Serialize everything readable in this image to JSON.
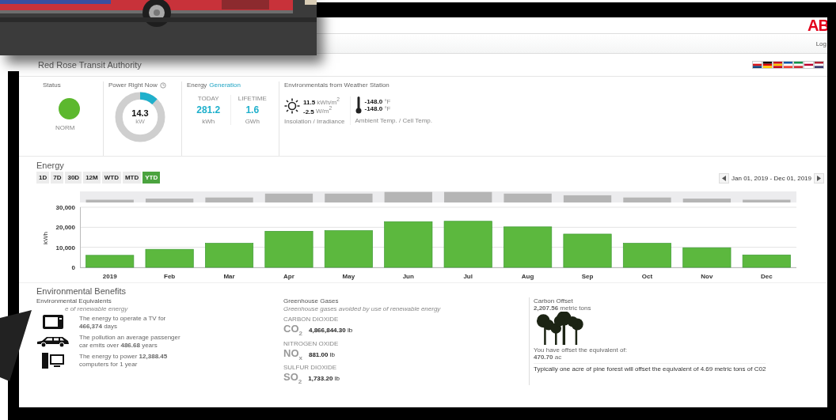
{
  "header": {
    "logo": "AB",
    "nav_link": "Log"
  },
  "title": "Red Rose Transit Authority",
  "kpis": {
    "status": {
      "label": "Status",
      "value": "NORM",
      "color": "#5cb82e"
    },
    "power": {
      "label": "Power Right Now",
      "value": "14.3",
      "unit": "kW",
      "level": 0.12
    },
    "energy": {
      "title": "Energy",
      "title_link": "Generation",
      "today_label": "TODAY",
      "today_value": "281.2",
      "today_unit": "kWh",
      "lifetime_label": "LIFETIME",
      "lifetime_value": "1.6",
      "lifetime_unit": "GWh"
    },
    "weather": {
      "label": "Environmentals from Weather Station",
      "insolation": "11.5",
      "insolation_unit": "kWh/m$^{2}$",
      "irradiance": "-2.5",
      "irradiance_unit": "W/m$^{2}$",
      "sun_caption": "Insolation / Irradiance",
      "ambient": "-148.0",
      "ambient_unit": "°F",
      "cell": "-148.0",
      "cell_unit": "°F",
      "temp_caption": "Ambient Temp. / Cell Temp."
    }
  },
  "energy": {
    "heading": "Energy",
    "ranges": [
      {
        "label": "1D",
        "selected": false
      },
      {
        "label": "7D",
        "selected": false
      },
      {
        "label": "30D",
        "selected": false
      },
      {
        "label": "12M",
        "selected": false
      },
      {
        "label": "WTD",
        "selected": false
      },
      {
        "label": "MTD",
        "selected": false
      },
      {
        "label": "YTD",
        "selected": true
      }
    ],
    "date_range": "Jan 01, 2019 - Dec 01, 2019",
    "chart_data": {
      "type": "bar",
      "ylabel": "kWh",
      "categories": [
        "2019",
        "Feb",
        "Mar",
        "Apr",
        "May",
        "Jun",
        "Jul",
        "Aug",
        "Sep",
        "Oct",
        "Nov",
        "Dec"
      ],
      "series": [
        {
          "color": "#5cb83e",
          "values": [
            6000,
            9000,
            12000,
            18000,
            18300,
            22800,
            23000,
            20200,
            16600,
            12000,
            9800,
            6200
          ]
        }
      ],
      "ylim": [
        0,
        30000
      ],
      "yticks": [
        {
          "value": 0,
          "label": "0"
        },
        {
          "value": 10000,
          "label": "10,000"
        },
        {
          "value": 20000,
          "label": "20,000"
        },
        {
          "value": 30000,
          "label": "30,000"
        }
      ]
    }
  },
  "benefits": {
    "heading": "Environmental Benefits",
    "equivalents": {
      "title": "Environmental Equivalents",
      "subtitle": "e of renewable energy",
      "items": [
        {
          "kind": "tv",
          "text": "The energy to operate a TV for **466,374** days"
        },
        {
          "kind": "car",
          "text": "The pollution an average passenger car emits over **486.68** years"
        },
        {
          "kind": "computer",
          "text": "The energy to power **12,388.45** computers for 1 year"
        }
      ]
    },
    "gases": {
      "title": "Greenhouse Gases",
      "subtitle": "Greenhouse gases avoided by use of renewable energy",
      "items": [
        {
          "label": "CARBON DIOXIDE",
          "formula": "CO$_{2}$",
          "value": "4,866,844.30",
          "unit": "lb"
        },
        {
          "label": "NITROGEN OXIDE",
          "formula": "NO$_{x}$",
          "value": "881.00",
          "unit": "lb"
        },
        {
          "label": "SULFUR DIOXIDE",
          "formula": "SO$_{2}$",
          "value": "1,733.20",
          "unit": "lb"
        }
      ]
    },
    "offset": {
      "title": "Carbon Offset",
      "amount": "**2,207.56** metric tons",
      "equivalent_label": "You have offset the equivalent of:",
      "equivalent": "**470.70** ac",
      "note": "Typically one acre of pine forest will offset the equivalent of 4.69 metric tons of C02"
    }
  }
}
